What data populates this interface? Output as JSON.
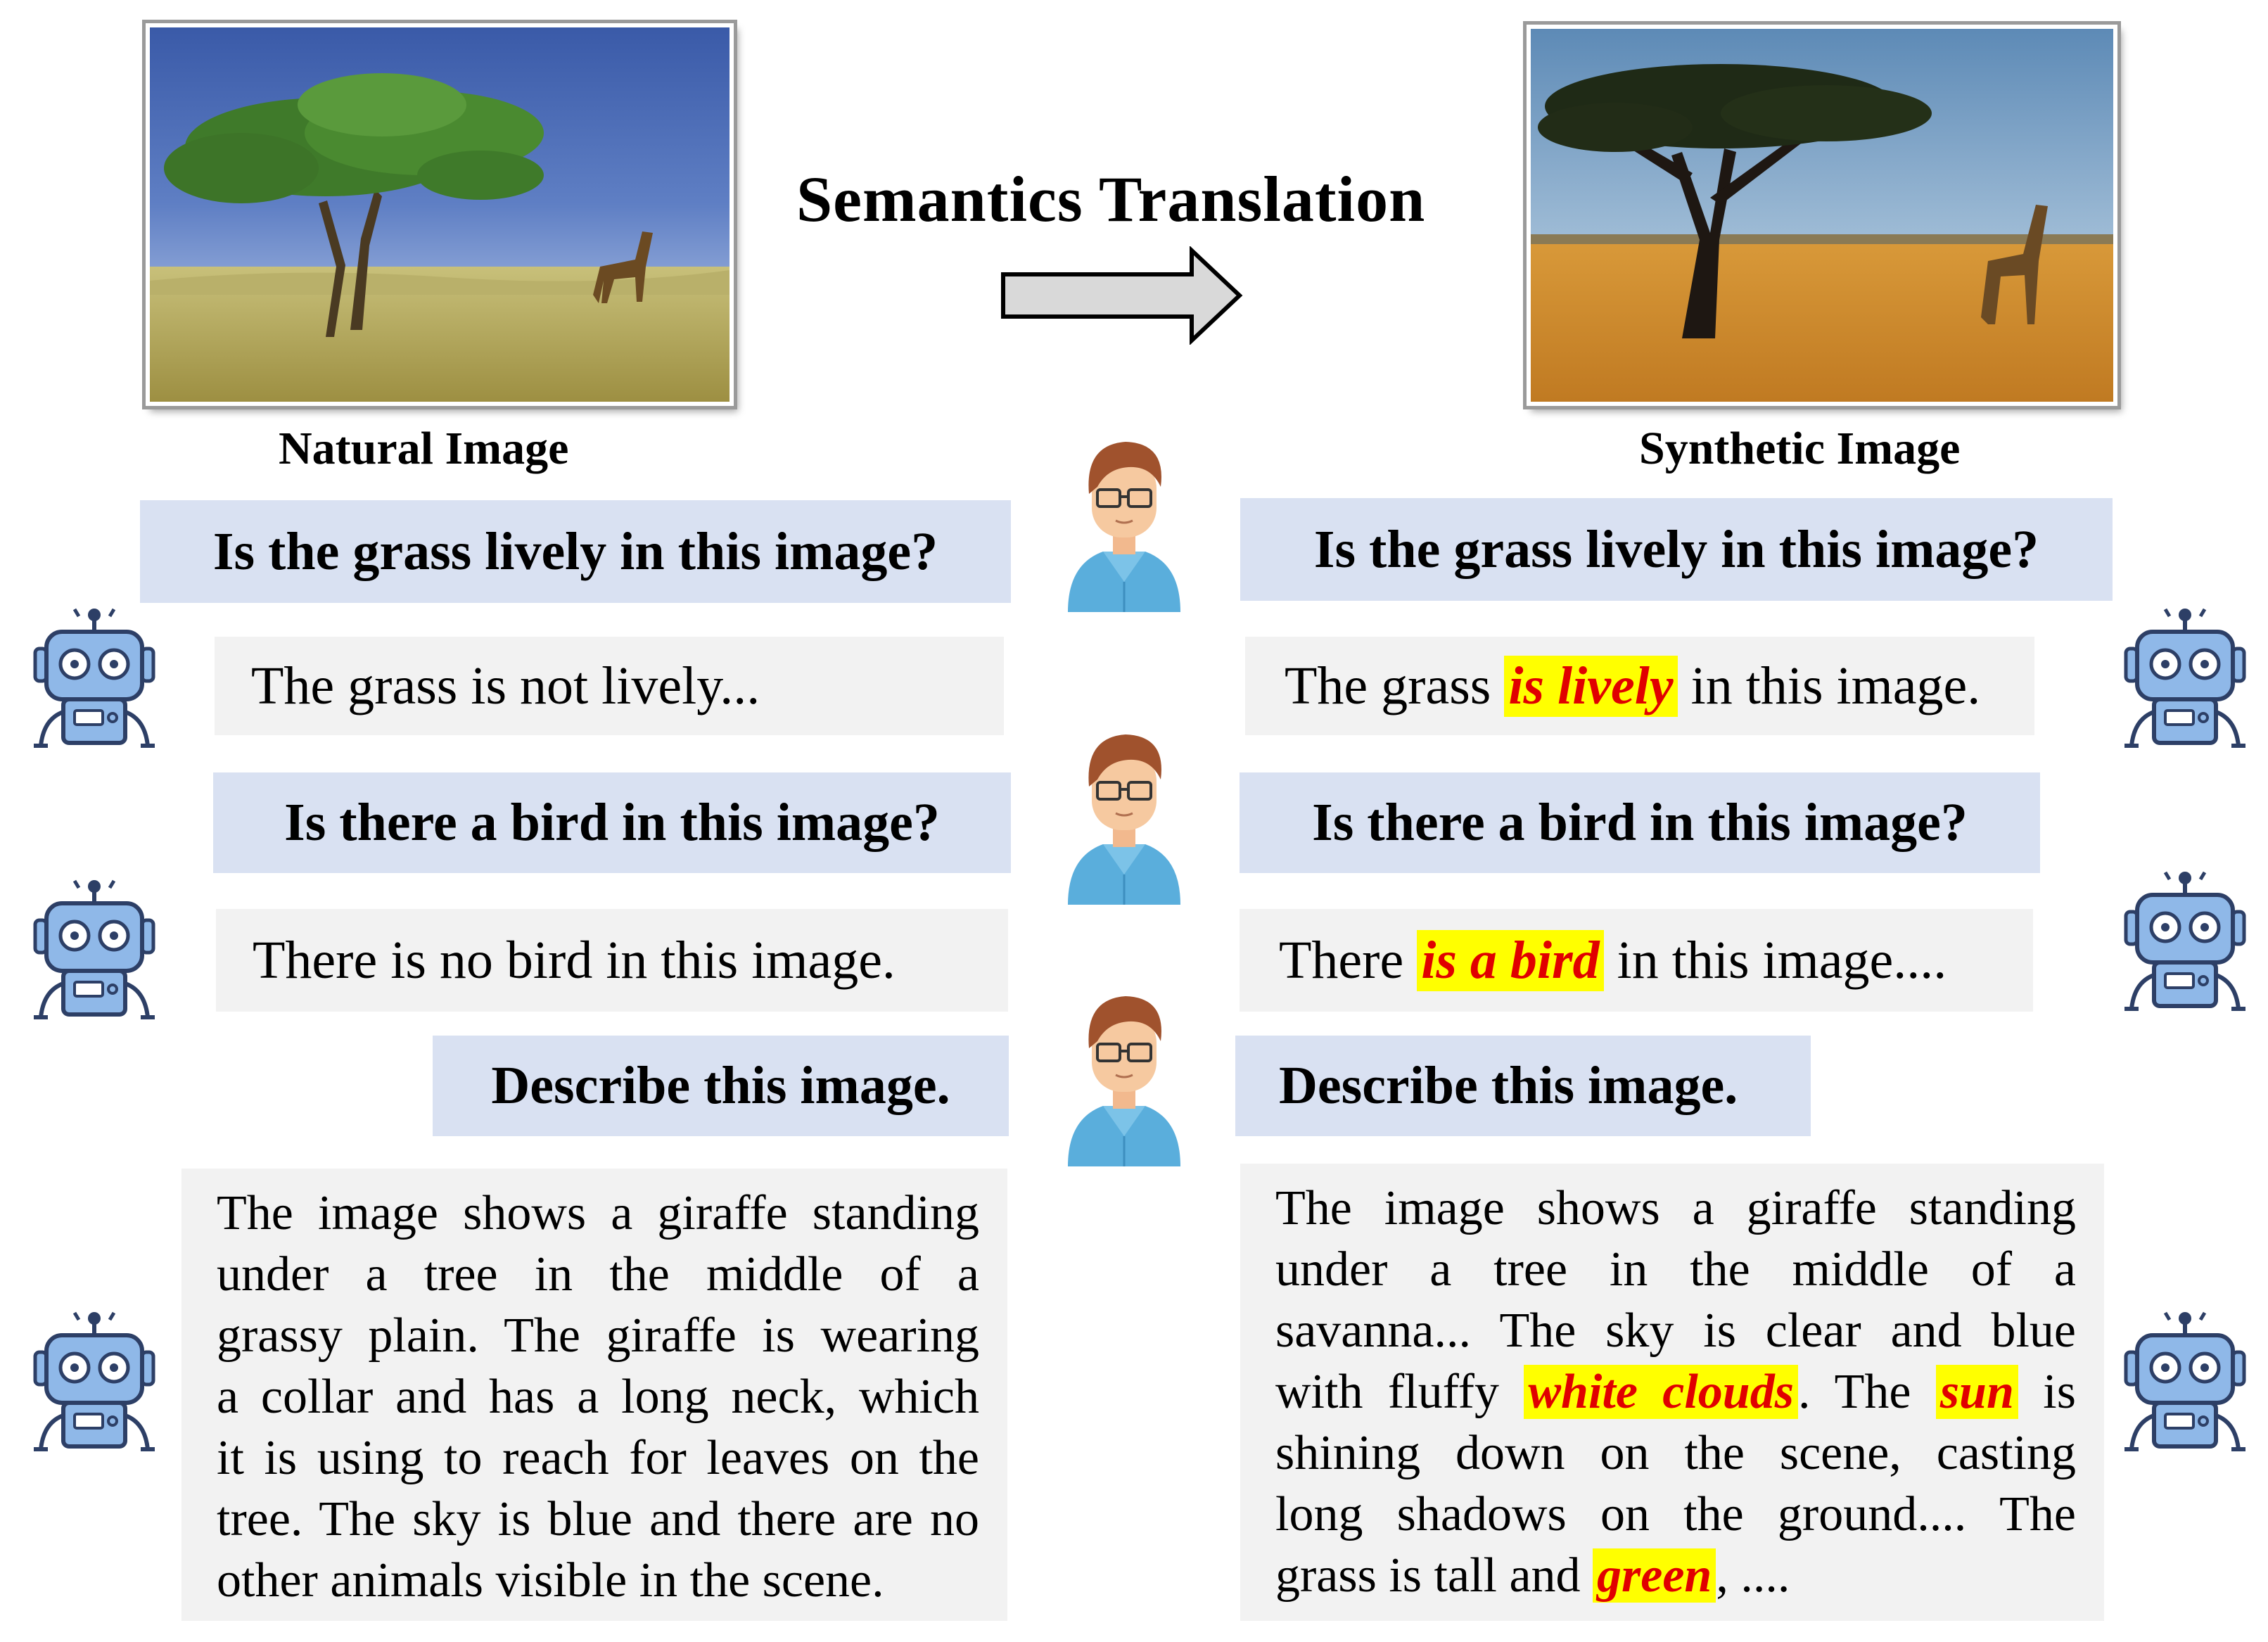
{
  "title": "Semantics Translation",
  "left": {
    "caption": "Natural Image",
    "q1": "Is the grass lively in this image?",
    "a1": "The grass is not lively...",
    "q2": "Is there a bird in this image?",
    "a2": "There is no bird in this image.",
    "q3": "Describe this image.",
    "desc": [
      "The image shows a giraffe standing",
      "under a tree in the middle of a",
      "grassy plain. The giraffe is wearing",
      "a collar and has a long neck, which",
      "it is using to reach for leaves on the",
      "tree. The sky is blue and there are no",
      "other animals visible in the scene."
    ]
  },
  "right": {
    "caption": "Synthetic Image",
    "q1": "Is the grass lively in this image?",
    "a1": {
      "before": "The grass ",
      "highlight": "is lively",
      "after": " in this image."
    },
    "q2": "Is there a bird in this image?",
    "a2": {
      "before": "There ",
      "highlight": "is a bird",
      "after": " in this image...."
    },
    "q3": "Describe this image.",
    "desc": {
      "l1": "The image shows a giraffe standing",
      "l2": "under a tree in the middle of a",
      "l3": "savanna... The sky is clear and blue",
      "l4a": "with fluffy ",
      "l4h1": "white clouds",
      "l4b": ". The ",
      "l4h2": "sun",
      "l4c": " is",
      "l5": "shining down on the scene, casting",
      "l6": "long shadows on the ground.... The",
      "l7a": "grass is tall and ",
      "l7h": "green",
      "l7b": ", ...."
    }
  },
  "colors": {
    "question_bg": "#d9e1f2",
    "answer_bg": "#f2f2f2",
    "highlight_bg": "#ffff00",
    "highlight_text": "#e00000",
    "robot_body": "#8fb8e8",
    "robot_outline": "#2d3f66",
    "user_shirt": "#5aaedc",
    "user_hair": "#a0522d"
  },
  "icons": [
    "user-icon",
    "robot-icon",
    "arrow-right-icon"
  ]
}
